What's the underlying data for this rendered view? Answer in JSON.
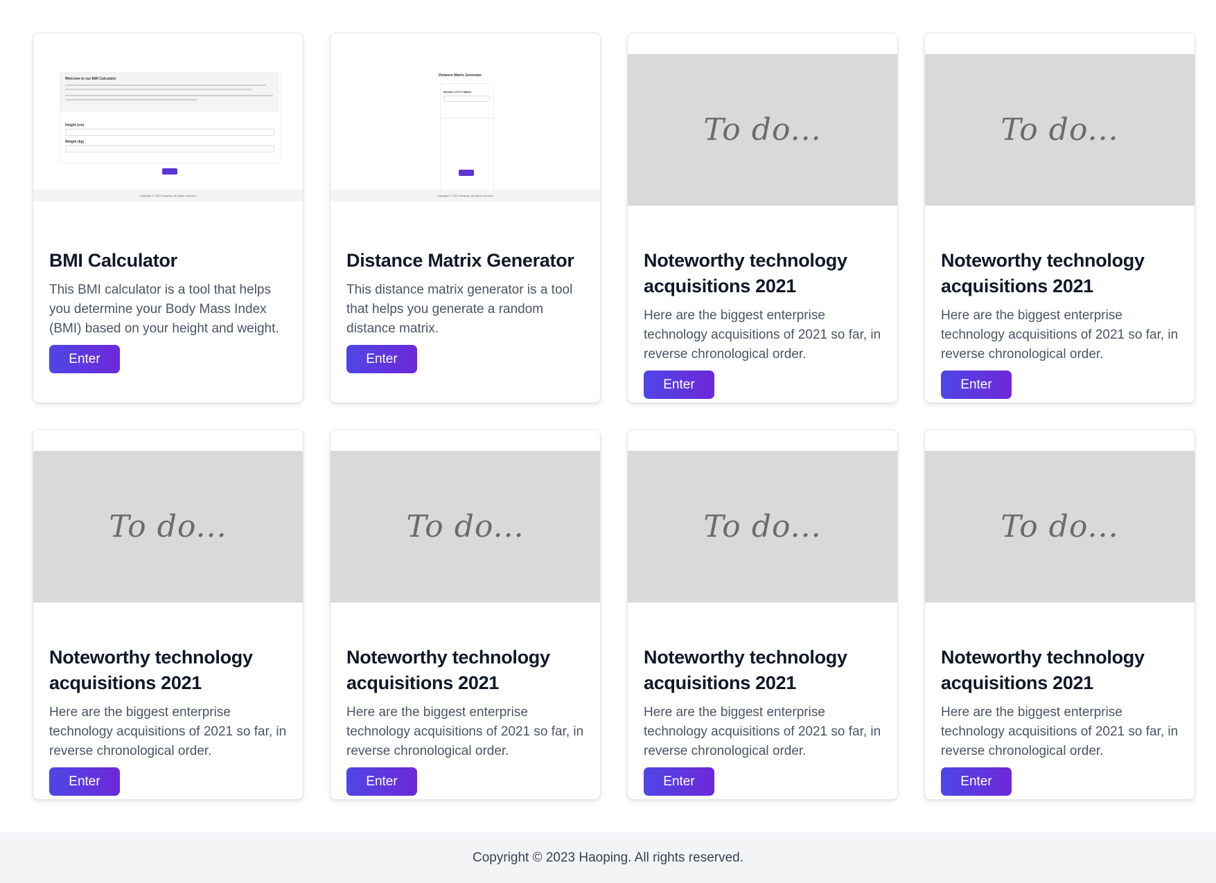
{
  "cards": [
    {
      "title": "BMI Calculator",
      "description": "This BMI calculator is a tool that helps you determine your Body Mass Index (BMI) based on your height and weight.",
      "button": "Enter",
      "preview": {
        "heading": "Welcome to our BMI Calculator",
        "height_label": "Height (cm)",
        "weight_label": "Weight (kg)",
        "footer": "Copyright © 2023 Haoping. All rights reserved."
      }
    },
    {
      "title": "Distance Matrix Generator",
      "description": "This distance matrix generator is a tool that helps you generate a random distance matrix.",
      "button": "Enter",
      "preview": {
        "heading": "Distance Matrix Generator",
        "input_label": "Number of n*n Matrix",
        "footer": "Copyright © 2023 Haoping. All rights reserved."
      }
    },
    {
      "title": "Noteworthy technology acquisitions 2021",
      "description": "Here are the biggest enterprise technology acquisitions of 2021 so far, in reverse chronological order.",
      "button": "Enter",
      "image_text": "To do..."
    },
    {
      "title": "Noteworthy technology acquisitions 2021",
      "description": "Here are the biggest enterprise technology acquisitions of 2021 so far, in reverse chronological order.",
      "button": "Enter",
      "image_text": "To do..."
    },
    {
      "title": "Noteworthy technology acquisitions 2021",
      "description": "Here are the biggest enterprise technology acquisitions of 2021 so far, in reverse chronological order.",
      "button": "Enter",
      "image_text": "To do..."
    },
    {
      "title": "Noteworthy technology acquisitions 2021",
      "description": "Here are the biggest enterprise technology acquisitions of 2021 so far, in reverse chronological order.",
      "button": "Enter",
      "image_text": "To do..."
    },
    {
      "title": "Noteworthy technology acquisitions 2021",
      "description": "Here are the biggest enterprise technology acquisitions of 2021 so far, in reverse chronological order.",
      "button": "Enter",
      "image_text": "To do..."
    },
    {
      "title": "Noteworthy technology acquisitions 2021",
      "description": "Here are the biggest enterprise technology acquisitions of 2021 so far, in reverse chronological order.",
      "button": "Enter",
      "image_text": "To do..."
    }
  ],
  "footer": {
    "copyright": "Copyright © 2023 Haoping. All rights reserved."
  },
  "colors": {
    "button_gradient_start": "#4f46e5",
    "button_gradient_end": "#6d28d9",
    "placeholder_bg": "#d9d9d9",
    "footer_bg": "#f3f4f6"
  }
}
